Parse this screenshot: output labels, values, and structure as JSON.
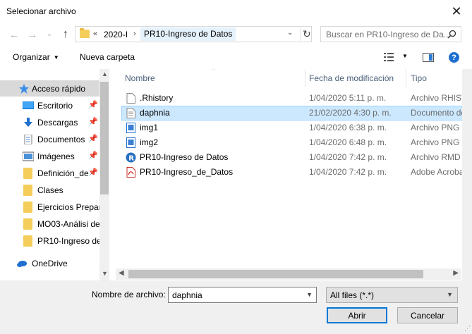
{
  "window": {
    "title": "Selecionar archivo",
    "close_glyph": "✕"
  },
  "nav": {
    "back_glyph": "←",
    "forward_glyph": "→",
    "recent_glyph": "⌄",
    "up_glyph": "↑",
    "address": {
      "overflow": "«",
      "segment1": "2020-I",
      "separator": "›",
      "segment2": "PR10-Ingreso de Datos",
      "dropdown_glyph": "⌄",
      "refresh_glyph": "↻"
    },
    "search_placeholder": "Buscar en PR10-Ingreso de Da..."
  },
  "toolbar": {
    "organize_label": "Organizar",
    "organize_caret": "▼",
    "new_folder_label": "Nueva carpeta",
    "view_dd_glyph": "▼",
    "help_glyph": "?"
  },
  "sidebar": {
    "items": [
      {
        "label": "Acceso rápido",
        "icon": "star-icon",
        "pinned": false
      },
      {
        "label": "Escritorio",
        "icon": "desktop-icon",
        "pinned": true
      },
      {
        "label": "Descargas",
        "icon": "download-icon",
        "pinned": true
      },
      {
        "label": "Documentos",
        "icon": "documents-icon",
        "pinned": true
      },
      {
        "label": "Imágenes",
        "icon": "pictures-icon",
        "pinned": true
      },
      {
        "label": "Definición_de",
        "icon": "folder-icon",
        "pinned": true
      },
      {
        "label": "Clases",
        "icon": "folder-icon",
        "pinned": false
      },
      {
        "label": "Ejercicios Prepar",
        "icon": "folder-icon",
        "pinned": false
      },
      {
        "label": "MO03-Análisi de",
        "icon": "folder-icon",
        "pinned": false
      },
      {
        "label": "PR10-Ingreso de",
        "icon": "folder-icon",
        "pinned": false
      },
      {
        "label": "OneDrive",
        "icon": "cloud-icon",
        "pinned": false
      }
    ],
    "pin_glyph": "📌"
  },
  "columns": {
    "name": "Nombre",
    "modified": "Fecha de modificación",
    "type": "Tipo"
  },
  "files": [
    {
      "name": ".Rhistory",
      "modified": "1/04/2020 5:11 p. m.",
      "type": "Archivo RHISTORY",
      "icon": "blank-file-icon",
      "selected": false
    },
    {
      "name": "daphnia",
      "modified": "21/02/2020 4:30 p. m.",
      "type": "Documento de texto",
      "icon": "text-file-icon",
      "selected": true
    },
    {
      "name": "img1",
      "modified": "1/04/2020 6:38 p. m.",
      "type": "Archivo PNG",
      "icon": "image-file-icon",
      "selected": false
    },
    {
      "name": "img2",
      "modified": "1/04/2020 6:48 p. m.",
      "type": "Archivo PNG",
      "icon": "image-file-icon",
      "selected": false
    },
    {
      "name": "PR10-Ingreso de Datos",
      "modified": "1/04/2020 7:42 p. m.",
      "type": "Archivo RMD",
      "icon": "r-file-icon",
      "selected": false
    },
    {
      "name": "PR10-Ingreso_de_Datos",
      "modified": "1/04/2020 7:42 p. m.",
      "type": "Adobe Acrobat Document",
      "icon": "pdf-file-icon",
      "selected": false
    }
  ],
  "footer": {
    "filename_label": "Nombre de archivo:",
    "filename_value": "daphnia",
    "filter_value": "All files (*.*)",
    "open_label": "Abrir",
    "cancel_label": "Cancelar"
  },
  "colors": {
    "selection_bg": "#cce8ff",
    "selection_border": "#99d1ff",
    "accent": "#0078d7"
  }
}
